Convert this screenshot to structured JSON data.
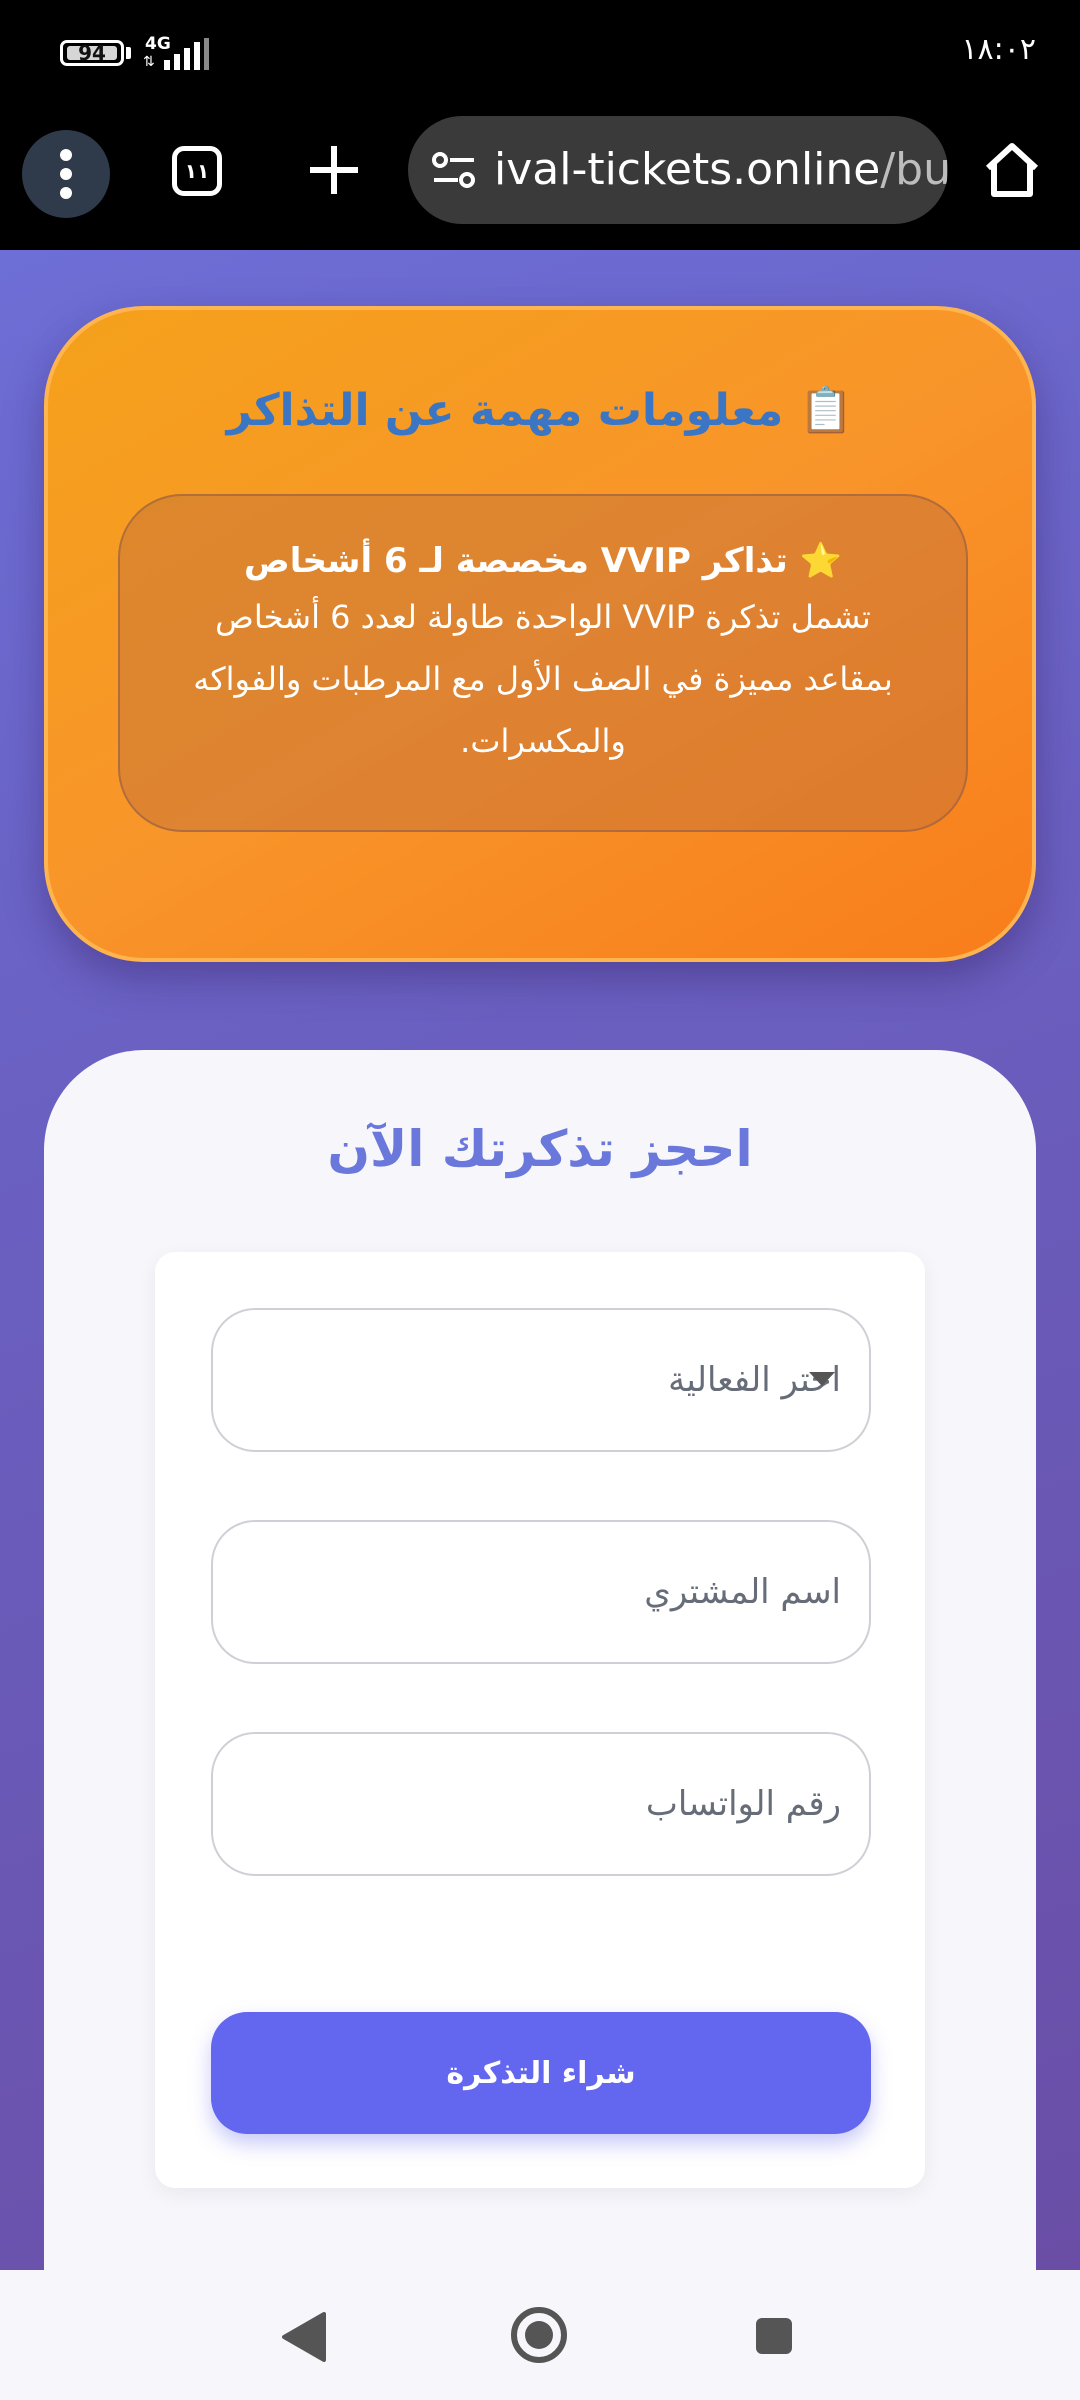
{
  "status_bar": {
    "battery": "94",
    "network": "4G",
    "data_arrows": "⇅",
    "time": "١٨:٠٢"
  },
  "browser": {
    "tab_count": "١١",
    "url_host": "ival-tickets.online",
    "url_path": "/buy"
  },
  "info": {
    "title": "📋 معلومات مهمة عن التذاكر",
    "box_heading": "⭐ تذاكر VVIP مخصصة لـ 6 أشخاص",
    "box_text": "تشمل تذكرة VVIP الواحدة طاولة لعدد 6 أشخاص بمقاعد مميزة في الصف الأول مع المرطبات والفواكه والمكسرات."
  },
  "form": {
    "title": "احجز تذكرتك الآن",
    "event_select_placeholder": "اختر الفعالية",
    "buyer_name_placeholder": "اسم المشتري",
    "whatsapp_placeholder": "رقم الواتساب",
    "buy_button_label": "شراء التذكرة"
  },
  "colors": {
    "accent": "#6366ee",
    "info_card": "#f8952a",
    "title_blue": "#3a76c4"
  }
}
